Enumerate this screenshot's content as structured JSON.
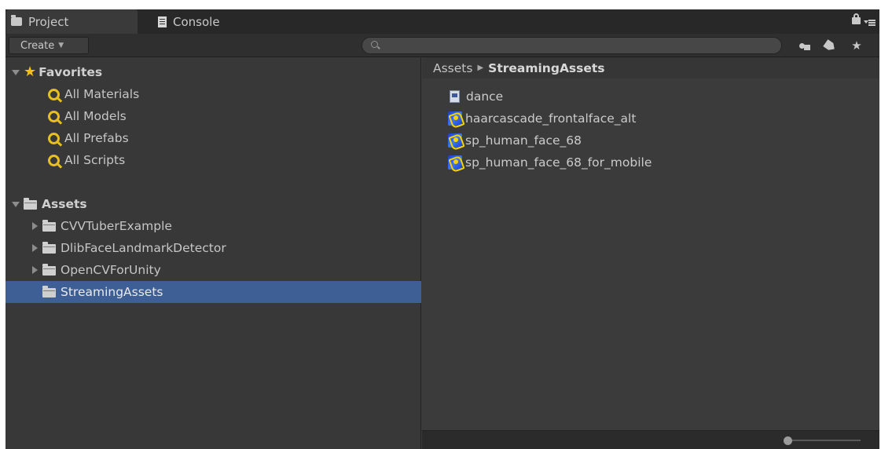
{
  "tabs": [
    {
      "label": "Project",
      "icon": "folder-icon",
      "active": true
    },
    {
      "label": "Console",
      "icon": "console-icon",
      "active": false
    }
  ],
  "toolbar": {
    "create_label": "Create",
    "search_value": "",
    "search_placeholder": ""
  },
  "left_tree": {
    "favorites": {
      "label": "Favorites",
      "items": [
        "All Materials",
        "All Models",
        "All Prefabs",
        "All Scripts"
      ]
    },
    "assets": {
      "label": "Assets",
      "folders": [
        {
          "label": "CVVTuberExample",
          "expandable": true,
          "selected": false
        },
        {
          "label": "DlibFaceLandmarkDetector",
          "expandable": true,
          "selected": false
        },
        {
          "label": "OpenCVForUnity",
          "expandable": true,
          "selected": false
        },
        {
          "label": "StreamingAssets",
          "expandable": false,
          "selected": true
        }
      ]
    }
  },
  "breadcrumb": {
    "root": "Assets",
    "current": "StreamingAssets"
  },
  "files": [
    {
      "name": "dance",
      "icon": "text-file-icon"
    },
    {
      "name": "haarcascade_frontalface_alt",
      "icon": "binary-file-icon"
    },
    {
      "name": "sp_human_face_68",
      "icon": "binary-file-icon"
    },
    {
      "name": "sp_human_face_68_for_mobile",
      "icon": "binary-file-icon"
    }
  ],
  "colors": {
    "selection": "#3e5f96",
    "panel_bg": "#383838",
    "favorite_star": "#f4c20d",
    "search_glass": "#e7c01e"
  },
  "icon_size_slider": {
    "value": 0
  }
}
